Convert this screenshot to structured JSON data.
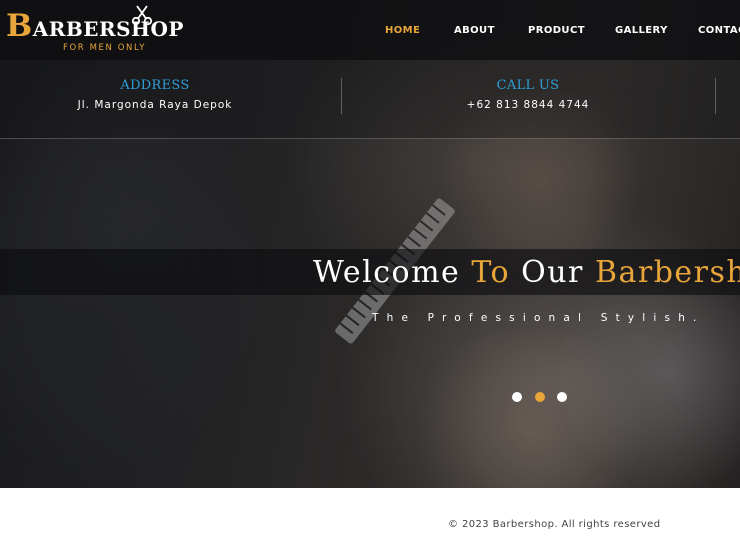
{
  "logo": {
    "initial": "B",
    "rest": "ARBERSHOP",
    "tagline": "FOR MEN ONLY",
    "icon": "scissors-icon"
  },
  "nav": {
    "items": [
      {
        "label": "HOME",
        "active": true
      },
      {
        "label": "ABOUT",
        "active": false
      },
      {
        "label": "PRODUCT",
        "active": false
      },
      {
        "label": "GALLERY",
        "active": false
      },
      {
        "label": "CONTACT",
        "active": false
      }
    ]
  },
  "info": {
    "address": {
      "title": "ADDRESS",
      "value": "Jl. Margonda Raya Depok"
    },
    "call": {
      "title": "CALL US",
      "value": "+62 813 8844 4744"
    }
  },
  "hero": {
    "welcome_part1": "Welcome ",
    "welcome_part2": "To",
    "welcome_part3": " Our ",
    "welcome_part4": "Barbershop",
    "subtitle": "The Professional Stylish."
  },
  "slider": {
    "dot_count": 3,
    "active_index": 1
  },
  "footer": {
    "copyright": "© 2023 Barbershop. All rights reserved"
  },
  "colors": {
    "accent": "#e8a53a",
    "info_title": "#2e9fd6",
    "header_bg": "#0f0f11"
  }
}
